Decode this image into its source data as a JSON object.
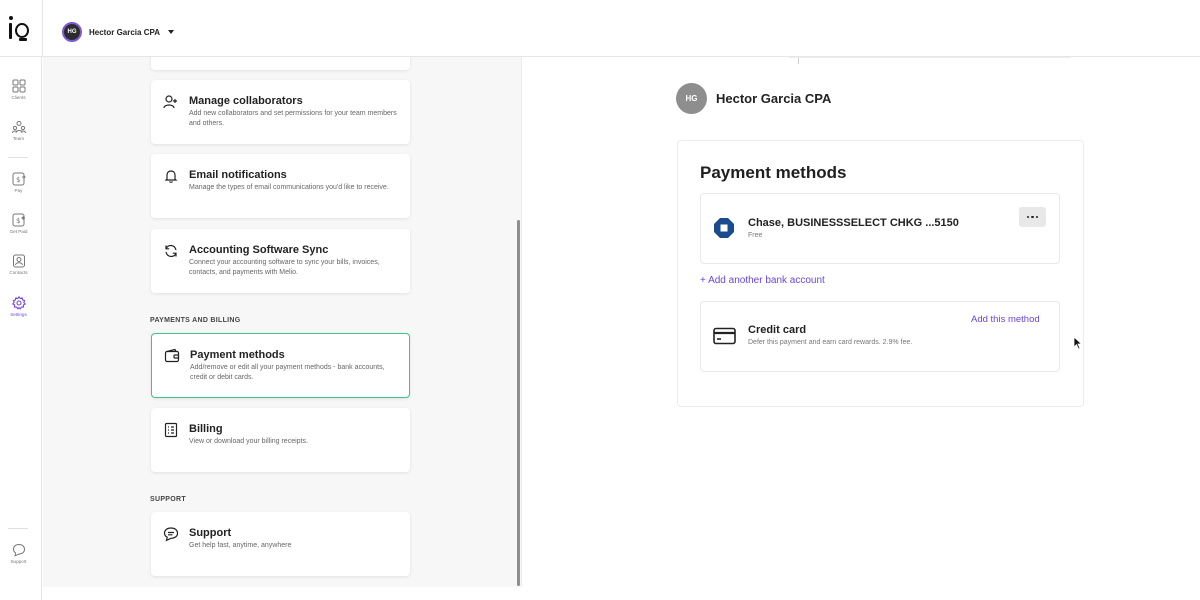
{
  "header": {
    "org_initials": "HG",
    "org_name": "Hector Garcia CPA"
  },
  "nav": {
    "items": [
      {
        "id": "clients",
        "label": "Clients",
        "icon": "grid-icon"
      },
      {
        "id": "team",
        "label": "Team",
        "icon": "team-icon"
      },
      {
        "id": "pay",
        "label": "Pay",
        "icon": "pay-icon"
      },
      {
        "id": "get_paid",
        "label": "Get Paid",
        "icon": "get-paid-icon"
      },
      {
        "id": "contacts",
        "label": "Contacts",
        "icon": "contacts-icon"
      },
      {
        "id": "settings",
        "label": "Settings",
        "icon": "gear-icon",
        "active": true
      }
    ],
    "support_label": "Support",
    "active_color": "#7849d8"
  },
  "settings_list": {
    "cards": [
      {
        "title": "Manage collaborators",
        "desc": "Add new collaborators and set permissions for your team members and others.",
        "icon": "add-user-icon"
      },
      {
        "title": "Email notifications",
        "desc": "Manage the types of email communications you'd like to receive.",
        "icon": "bell-icon"
      },
      {
        "title": "Accounting Software Sync",
        "desc": "Connect your accounting software to sync your bills, invoices, contacts, and payments with Melio.",
        "icon": "sync-icon"
      }
    ],
    "payments_section_label": "PAYMENTS AND BILLING",
    "payment_cards": [
      {
        "title": "Payment methods",
        "desc": "Add/remove or edit all your payment methods - bank accounts, credit or debit cards.",
        "icon": "wallet-icon",
        "selected": true
      },
      {
        "title": "Billing",
        "desc": "View or download your billing receipts.",
        "icon": "receipt-icon"
      }
    ],
    "support_section_label": "SUPPORT",
    "support_card": {
      "title": "Support",
      "desc": "Get help fast, anytime, anywhere",
      "icon": "chat-icon"
    },
    "selected_color": "#3ec48c"
  },
  "detail": {
    "avatar_initials": "HG",
    "company_name": "Hector Garcia CPA",
    "title": "Payment methods",
    "bank": {
      "name": "Chase, BUSINESSSELECT CHKG ...5150",
      "fee": "Free"
    },
    "add_bank_label": "+ Add another bank account",
    "credit_card": {
      "title": "Credit card",
      "desc": "Defer this payment and earn card rewards. 2.9% fee.",
      "action": "Add this method"
    },
    "link_color": "#6a47d0"
  }
}
